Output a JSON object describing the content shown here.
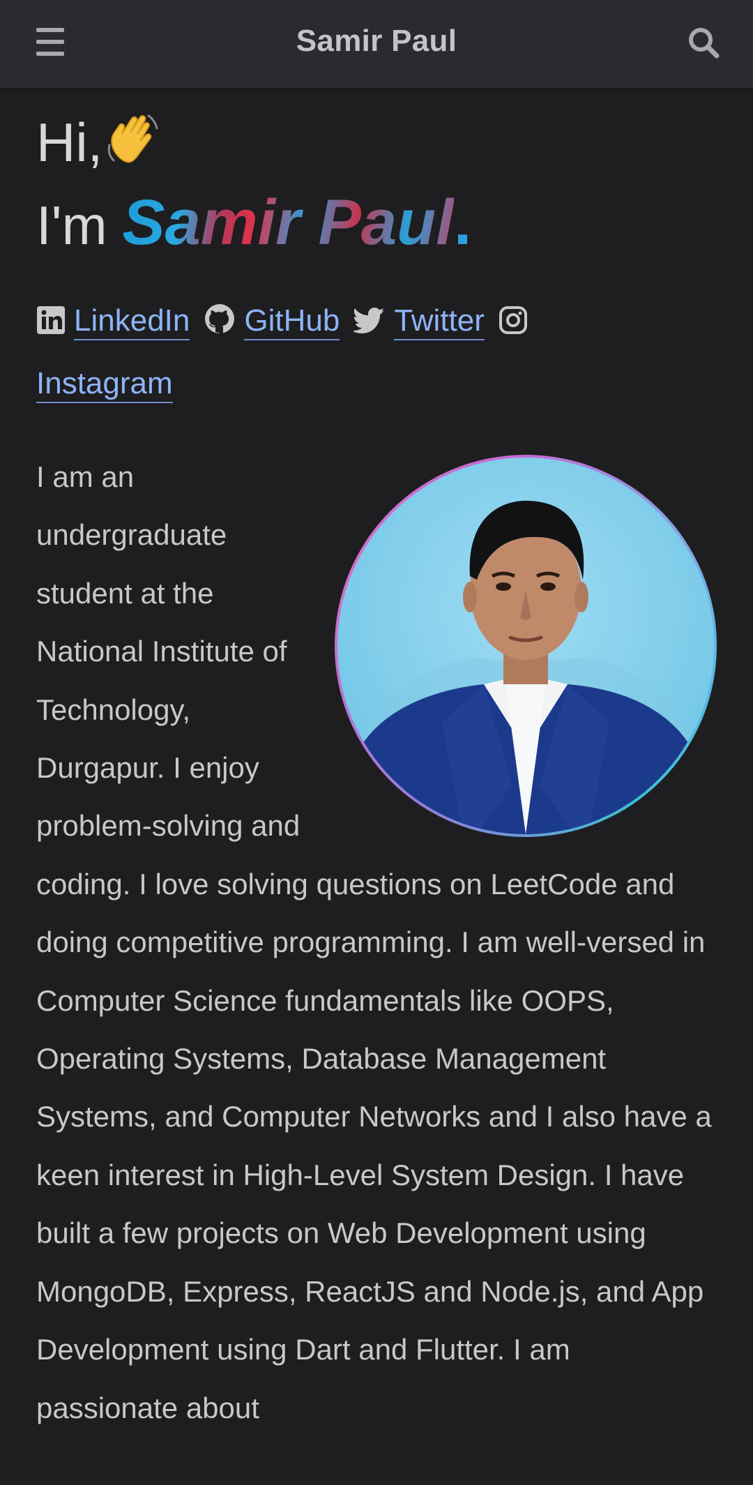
{
  "header": {
    "title": "Samir Paul",
    "menu_icon": "hamburger-menu-icon",
    "search_icon": "search-icon"
  },
  "hero": {
    "greeting": "Hi,",
    "wave_icon": "waving-hand-emoji",
    "intro": "I'm",
    "name": "Samir Paul",
    "name_dot": "."
  },
  "social": [
    {
      "label": "LinkedIn",
      "icon": "linkedin-icon"
    },
    {
      "label": "GitHub",
      "icon": "github-icon"
    },
    {
      "label": "Twitter",
      "icon": "twitter-icon"
    },
    {
      "label": "Instagram",
      "icon": "instagram-icon"
    }
  ],
  "about": {
    "text": "I am an undergraduate student at the National Institute of Technology, Durgapur. I enjoy problem-solving and coding. I love solving questions on LeetCode and doing competitive programming. I am well-versed in Computer Science fundamentals like OOPS, Operating Systems, Database Management Systems, and Computer Networks and I also have a keen interest in High-Level System Design. I have built a few projects on Web Development using MongoDB, Express, ReactJS and Node.js, and App Development using Dart and Flutter. I am passionate about"
  },
  "colors": {
    "background": "#1e1e20",
    "topbar": "#2a2b2f",
    "link": "#8eb4f5",
    "accent_blue": "#2f9fe0",
    "accent_red": "#e0324a"
  }
}
